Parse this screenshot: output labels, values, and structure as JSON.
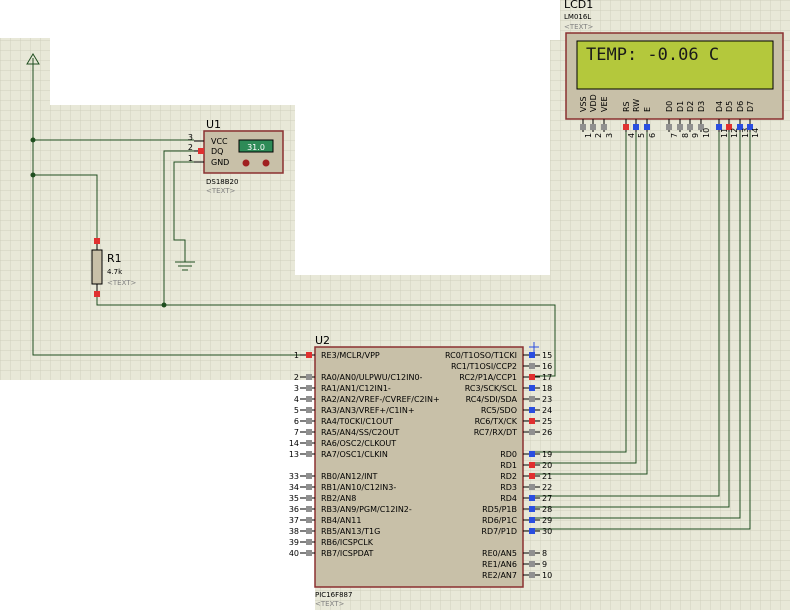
{
  "schematic": {
    "lcd": {
      "ref": "LCD1",
      "part": "LM016L",
      "text_tag": "<TEXT>",
      "display": "TEMP: -0.06 C",
      "pins": [
        {
          "num": "1",
          "name": "VSS",
          "color": "gray"
        },
        {
          "num": "2",
          "name": "VDD",
          "color": "gray"
        },
        {
          "num": "3",
          "name": "VEE",
          "color": "gray"
        },
        {
          "num": "4",
          "name": "RS",
          "color": "red"
        },
        {
          "num": "5",
          "name": "RW",
          "color": "blue"
        },
        {
          "num": "6",
          "name": "E",
          "color": "blue"
        },
        {
          "num": "7",
          "name": "D0",
          "color": "gray"
        },
        {
          "num": "8",
          "name": "D1",
          "color": "gray"
        },
        {
          "num": "9",
          "name": "D2",
          "color": "gray"
        },
        {
          "num": "10",
          "name": "D3",
          "color": "gray"
        },
        {
          "num": "11",
          "name": "D4",
          "color": "blue"
        },
        {
          "num": "12",
          "name": "D5",
          "color": "red"
        },
        {
          "num": "13",
          "name": "D6",
          "color": "blue"
        },
        {
          "num": "14",
          "name": "D7",
          "color": "blue"
        }
      ]
    },
    "u1": {
      "ref": "U1",
      "part": "DS18B20",
      "text_tag": "<TEXT>",
      "reading": "31.0",
      "pins": [
        {
          "num": "3",
          "name": "VCC"
        },
        {
          "num": "2",
          "name": "DQ"
        },
        {
          "num": "1",
          "name": "GND"
        }
      ]
    },
    "r1": {
      "ref": "R1",
      "value": "4.7k",
      "text_tag": "<TEXT>"
    },
    "u2": {
      "ref": "U2",
      "part": "PIC16F887",
      "text_tag": "<TEXT>",
      "left_pins": [
        {
          "num": "1",
          "name": "RE3/MCLR/VPP",
          "color": "red"
        },
        {
          "num": "2",
          "name": "RA0/AN0/ULPWU/C12IN0-",
          "color": "gray"
        },
        {
          "num": "3",
          "name": "RA1/AN1/C12IN1-",
          "color": "gray"
        },
        {
          "num": "4",
          "name": "RA2/AN2/VREF-/CVREF/C2IN+",
          "color": "gray"
        },
        {
          "num": "5",
          "name": "RA3/AN3/VREF+/C1IN+",
          "color": "gray"
        },
        {
          "num": "6",
          "name": "RA4/T0CKI/C1OUT",
          "color": "gray"
        },
        {
          "num": "7",
          "name": "RA5/AN4/SS/C2OUT",
          "color": "gray"
        },
        {
          "num": "14",
          "name": "RA6/OSC2/CLKOUT",
          "color": "gray"
        },
        {
          "num": "13",
          "name": "RA7/OSC1/CLKIN",
          "color": "gray"
        },
        {
          "num": "33",
          "name": "RB0/AN12/INT",
          "color": "gray"
        },
        {
          "num": "34",
          "name": "RB1/AN10/C12IN3-",
          "color": "gray"
        },
        {
          "num": "35",
          "name": "RB2/AN8",
          "color": "gray"
        },
        {
          "num": "36",
          "name": "RB3/AN9/PGM/C12IN2-",
          "color": "gray"
        },
        {
          "num": "37",
          "name": "RB4/AN11",
          "color": "gray"
        },
        {
          "num": "38",
          "name": "RB5/AN13/T1G",
          "color": "gray"
        },
        {
          "num": "39",
          "name": "RB6/ICSPCLK",
          "color": "gray"
        },
        {
          "num": "40",
          "name": "RB7/ICSPDAT",
          "color": "gray"
        }
      ],
      "right_pins": [
        {
          "num": "15",
          "name": "RC0/T1OSO/T1CKI",
          "color": "blue"
        },
        {
          "num": "16",
          "name": "RC1/T1OSI/CCP2",
          "color": "gray"
        },
        {
          "num": "17",
          "name": "RC2/P1A/CCP1",
          "color": "red"
        },
        {
          "num": "18",
          "name": "RC3/SCK/SCL",
          "color": "blue"
        },
        {
          "num": "23",
          "name": "RC4/SDI/SDA",
          "color": "gray"
        },
        {
          "num": "24",
          "name": "RC5/SDO",
          "color": "blue"
        },
        {
          "num": "25",
          "name": "RC6/TX/CK",
          "color": "red"
        },
        {
          "num": "26",
          "name": "RC7/RX/DT",
          "color": "gray"
        },
        {
          "num": "19",
          "name": "RD0",
          "color": "blue"
        },
        {
          "num": "20",
          "name": "RD1",
          "color": "red"
        },
        {
          "num": "21",
          "name": "RD2",
          "color": "red"
        },
        {
          "num": "22",
          "name": "RD3",
          "color": "gray"
        },
        {
          "num": "27",
          "name": "RD4",
          "color": "blue"
        },
        {
          "num": "28",
          "name": "RD5/P1B",
          "color": "blue"
        },
        {
          "num": "29",
          "name": "RD6/P1C",
          "color": "blue"
        },
        {
          "num": "30",
          "name": "RD7/P1D",
          "color": "blue"
        },
        {
          "num": "8",
          "name": "RE0/AN5",
          "color": "gray"
        },
        {
          "num": "9",
          "name": "RE1/AN6",
          "color": "gray"
        },
        {
          "num": "10",
          "name": "RE2/AN7",
          "color": "gray"
        }
      ]
    },
    "colors": {
      "grid_bg": "#e8e8d8",
      "grid_line": "#d0d0c0",
      "component_fill": "#c8c0a8",
      "wire": "#1f4e1f",
      "lcd_screen": "#b4c83c",
      "pin_red": "#e03030",
      "pin_blue": "#2a4ee0",
      "pin_gray": "#909090"
    }
  }
}
